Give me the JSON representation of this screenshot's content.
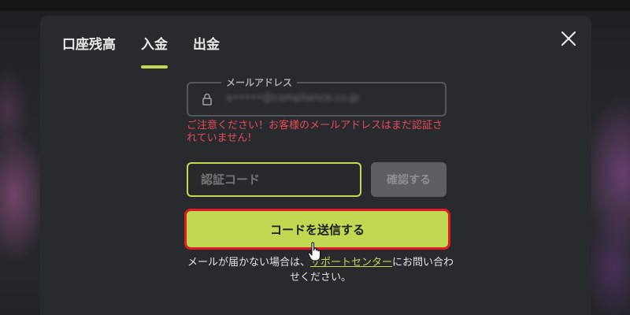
{
  "tabs": [
    {
      "label": "口座残高",
      "active": false
    },
    {
      "label": "入金",
      "active": true
    },
    {
      "label": "出金",
      "active": false
    }
  ],
  "close_icon": "close-icon",
  "email": {
    "legend": "メールアドレス",
    "value": "a•••••@compliance.co.jp",
    "icon": "lock-icon"
  },
  "warning": "ご注意ください！お客様のメールアドレスはまだ認証されていません!",
  "code": {
    "placeholder": "認証コード",
    "confirm_label": "確認する"
  },
  "send_label": "コードを送信する",
  "help": {
    "prefix": "メールが届かない場合は、",
    "link": "サポートセンター",
    "suffix": "にお問い合わせください。"
  },
  "colors": {
    "accent": "#c0d852",
    "warning": "#e84a5a",
    "highlight": "#e01b24",
    "modal_bg": "#282a2e"
  }
}
